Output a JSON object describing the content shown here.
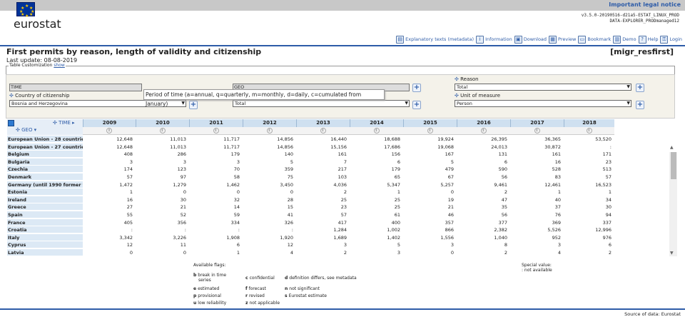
{
  "header": {
    "legal_notice": "Important legal notice",
    "logo": "eurostat",
    "version_line1": "v3.5.0-20190516-d21a5-ESTAT_LINUX_PROD",
    "version_line2": "DATA-EXPLORER_PRODmanaged12"
  },
  "toolbar": [
    {
      "label": "Explanatory texts (metadata)",
      "icon": "book-icon"
    },
    {
      "label": "Information",
      "icon": "info-icon"
    },
    {
      "label": "Download",
      "icon": "save-icon"
    },
    {
      "label": "Preview",
      "icon": "print-icon"
    },
    {
      "label": "Bookmark",
      "icon": "folder-icon"
    },
    {
      "label": "Demo",
      "icon": "film-icon"
    },
    {
      "label": "Help",
      "icon": "help-icon"
    },
    {
      "label": "Login",
      "icon": "key-icon"
    }
  ],
  "page": {
    "title": "First permits by reason, length of validity and citizenship",
    "code": "[migr_resfirst]",
    "last_update": "Last update: 08-08-2019",
    "customization_label": "Table Customization",
    "customization_link": "show"
  },
  "filters": {
    "reason_label": "Reason",
    "reason_value": "Total",
    "unit_label": "Unit of measure",
    "unit_value": "Person",
    "citizenship_label": "Country of citizenship",
    "citizenship_value": "Bosnia and Herzegovina",
    "time_box": "TIME",
    "geo_box": "GEO",
    "geo_value": "Total",
    "tooltip": "Period of time (a=annual, q=quarterly, m=monthly, d=daily, c=cumulated from January)"
  },
  "grid": {
    "time_label": "TIME",
    "geo_label": "GEO",
    "years": [
      "2009",
      "2010",
      "2011",
      "2012",
      "2013",
      "2014",
      "2015",
      "2016",
      "2017",
      "2018"
    ],
    "rows": [
      {
        "geo": "European Union - 28 countrie",
        "vals": [
          "12,648",
          "11,013",
          "11,717",
          "14,856",
          "16,440",
          "18,688",
          "19,924",
          "26,395",
          "36,365",
          "53,520"
        ]
      },
      {
        "geo": "European Union - 27 countrie",
        "vals": [
          "12,648",
          "11,013",
          "11,717",
          "14,856",
          "15,156",
          "17,686",
          "19,068",
          "24,013",
          "30,872",
          ":"
        ]
      },
      {
        "geo": "Belgium",
        "vals": [
          "408",
          "286",
          "179",
          "140",
          "161",
          "156",
          "167",
          "131",
          "161",
          "171"
        ]
      },
      {
        "geo": "Bulgaria",
        "vals": [
          "3",
          "3",
          "3",
          "5",
          "7",
          "6",
          "5",
          "6",
          "16",
          "23"
        ]
      },
      {
        "geo": "Czechia",
        "vals": [
          "174",
          "123",
          "70",
          "359",
          "217",
          "179",
          "479",
          "590",
          "528",
          "513"
        ]
      },
      {
        "geo": "Denmark",
        "vals": [
          "57",
          "97",
          "58",
          "75",
          "103",
          "65",
          "67",
          "56",
          "83",
          "57"
        ]
      },
      {
        "geo": "Germany (until 1990 former t",
        "vals": [
          "1,472",
          "1,279",
          "1,462",
          "3,450",
          "4,036",
          "5,347",
          "5,257",
          "9,461",
          "12,461",
          "16,523"
        ]
      },
      {
        "geo": "Estonia",
        "vals": [
          "1",
          "0",
          "0",
          "0",
          "2",
          "1",
          "0",
          "2",
          "1",
          "1"
        ]
      },
      {
        "geo": "Ireland",
        "vals": [
          "16",
          "30",
          "32",
          "28",
          "25",
          "25",
          "19",
          "47",
          "40",
          "34"
        ]
      },
      {
        "geo": "Greece",
        "vals": [
          "27",
          "21",
          "14",
          "15",
          "23",
          "25",
          "21",
          "35",
          "37",
          "30"
        ]
      },
      {
        "geo": "Spain",
        "vals": [
          "55",
          "52",
          "59",
          "41",
          "57",
          "61",
          "46",
          "56",
          "76",
          "94"
        ]
      },
      {
        "geo": "France",
        "vals": [
          "405",
          "356",
          "334",
          "326",
          "417",
          "400",
          "357",
          "377",
          "369",
          "337"
        ]
      },
      {
        "geo": "Croatia",
        "vals": [
          ":",
          ":",
          ":",
          ":",
          "1,284",
          "1,002",
          "866",
          "2,382",
          "5,526",
          "12,996"
        ]
      },
      {
        "geo": "Italy",
        "vals": [
          "3,342",
          "3,226",
          "1,908",
          "1,920",
          "1,689",
          "1,402",
          "1,556",
          "1,040",
          "952",
          "976"
        ]
      },
      {
        "geo": "Cyprus",
        "vals": [
          "12",
          "11",
          "6",
          "12",
          "3",
          "5",
          "3",
          "8",
          "3",
          "6"
        ]
      },
      {
        "geo": "Latvia",
        "vals": [
          "0",
          "0",
          "1",
          "4",
          "2",
          "3",
          "0",
          "2",
          "4",
          "2"
        ]
      }
    ]
  },
  "flags": {
    "heading": "Available flags:",
    "items": [
      {
        "code": "b",
        "text": "break in time"
      },
      {
        "code": "",
        "text": "series"
      },
      {
        "code": "c",
        "text": "confidential"
      },
      {
        "code": "d",
        "text": "definition differs, see metadata"
      },
      {
        "code": "e",
        "text": "estimated"
      },
      {
        "code": "f",
        "text": "forecast"
      },
      {
        "code": "n",
        "text": "not significant"
      },
      {
        "code": "p",
        "text": "provisional"
      },
      {
        "code": "r",
        "text": "revised"
      },
      {
        "code": "s",
        "text": "Eurostat estimate"
      },
      {
        "code": "u",
        "text": "low reliability"
      },
      {
        "code": "z",
        "text": "not applicable"
      }
    ],
    "special_heading": "Special value:",
    "special_value": ":   not available"
  },
  "footer": {
    "source": "Source of data: Eurostat"
  }
}
